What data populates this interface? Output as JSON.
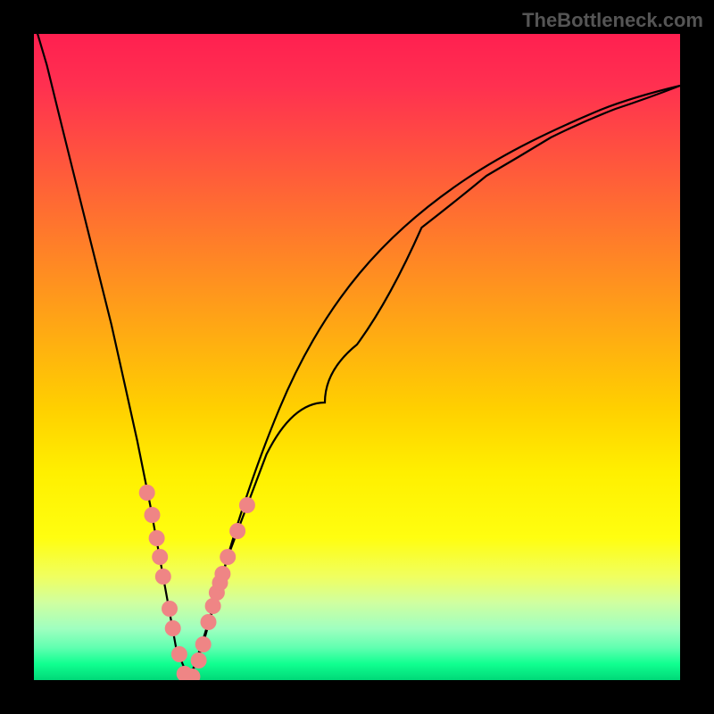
{
  "watermark": "TheBottleneck.com",
  "chart_data": {
    "type": "line",
    "title": "",
    "xlabel": "",
    "ylabel": "",
    "x_range": [
      0,
      100
    ],
    "y_range": [
      0,
      100
    ],
    "description": "V-shaped bottleneck curve with gradient background from red (top/high bottleneck) to green (bottom/no bottleneck). Minimum at approximately x=24.",
    "curve": {
      "minimum_x": 24,
      "left_branch_points": [
        {
          "x": 0,
          "y": 102
        },
        {
          "x": 2,
          "y": 95
        },
        {
          "x": 4,
          "y": 87
        },
        {
          "x": 6,
          "y": 79
        },
        {
          "x": 8,
          "y": 71
        },
        {
          "x": 10,
          "y": 63
        },
        {
          "x": 12,
          "y": 55
        },
        {
          "x": 14,
          "y": 46
        },
        {
          "x": 16,
          "y": 37
        },
        {
          "x": 18,
          "y": 27
        },
        {
          "x": 20,
          "y": 16
        },
        {
          "x": 22,
          "y": 5
        },
        {
          "x": 24,
          "y": 0
        }
      ],
      "right_branch_points": [
        {
          "x": 24,
          "y": 0
        },
        {
          "x": 26,
          "y": 5
        },
        {
          "x": 28,
          "y": 12
        },
        {
          "x": 30,
          "y": 19
        },
        {
          "x": 33,
          "y": 27
        },
        {
          "x": 36,
          "y": 35
        },
        {
          "x": 40,
          "y": 43
        },
        {
          "x": 45,
          "y": 52
        },
        {
          "x": 50,
          "y": 59
        },
        {
          "x": 55,
          "y": 65
        },
        {
          "x": 60,
          "y": 70
        },
        {
          "x": 65,
          "y": 74
        },
        {
          "x": 70,
          "y": 78
        },
        {
          "x": 75,
          "y": 81
        },
        {
          "x": 80,
          "y": 84
        },
        {
          "x": 85,
          "y": 86.5
        },
        {
          "x": 90,
          "y": 88.5
        },
        {
          "x": 95,
          "y": 90.5
        },
        {
          "x": 100,
          "y": 92
        }
      ]
    },
    "data_points": [
      {
        "x": 17.5,
        "y": 29
      },
      {
        "x": 18.3,
        "y": 25.5
      },
      {
        "x": 19,
        "y": 22
      },
      {
        "x": 19.5,
        "y": 19
      },
      {
        "x": 20,
        "y": 16
      },
      {
        "x": 21,
        "y": 11
      },
      {
        "x": 21.5,
        "y": 8
      },
      {
        "x": 22.5,
        "y": 4
      },
      {
        "x": 23.3,
        "y": 1
      },
      {
        "x": 24.5,
        "y": 0.5
      },
      {
        "x": 25.5,
        "y": 3
      },
      {
        "x": 26.2,
        "y": 5.5
      },
      {
        "x": 27,
        "y": 9
      },
      {
        "x": 27.7,
        "y": 11.5
      },
      {
        "x": 28.3,
        "y": 13.5
      },
      {
        "x": 28.8,
        "y": 15
      },
      {
        "x": 29.2,
        "y": 16.5
      },
      {
        "x": 30,
        "y": 19
      },
      {
        "x": 31.5,
        "y": 23
      },
      {
        "x": 33,
        "y": 27
      }
    ],
    "color_mapping": {
      "top": "#ff2050",
      "bottom": "#00d878",
      "meaning": "red = high bottleneck, green = optimal/no bottleneck"
    }
  }
}
